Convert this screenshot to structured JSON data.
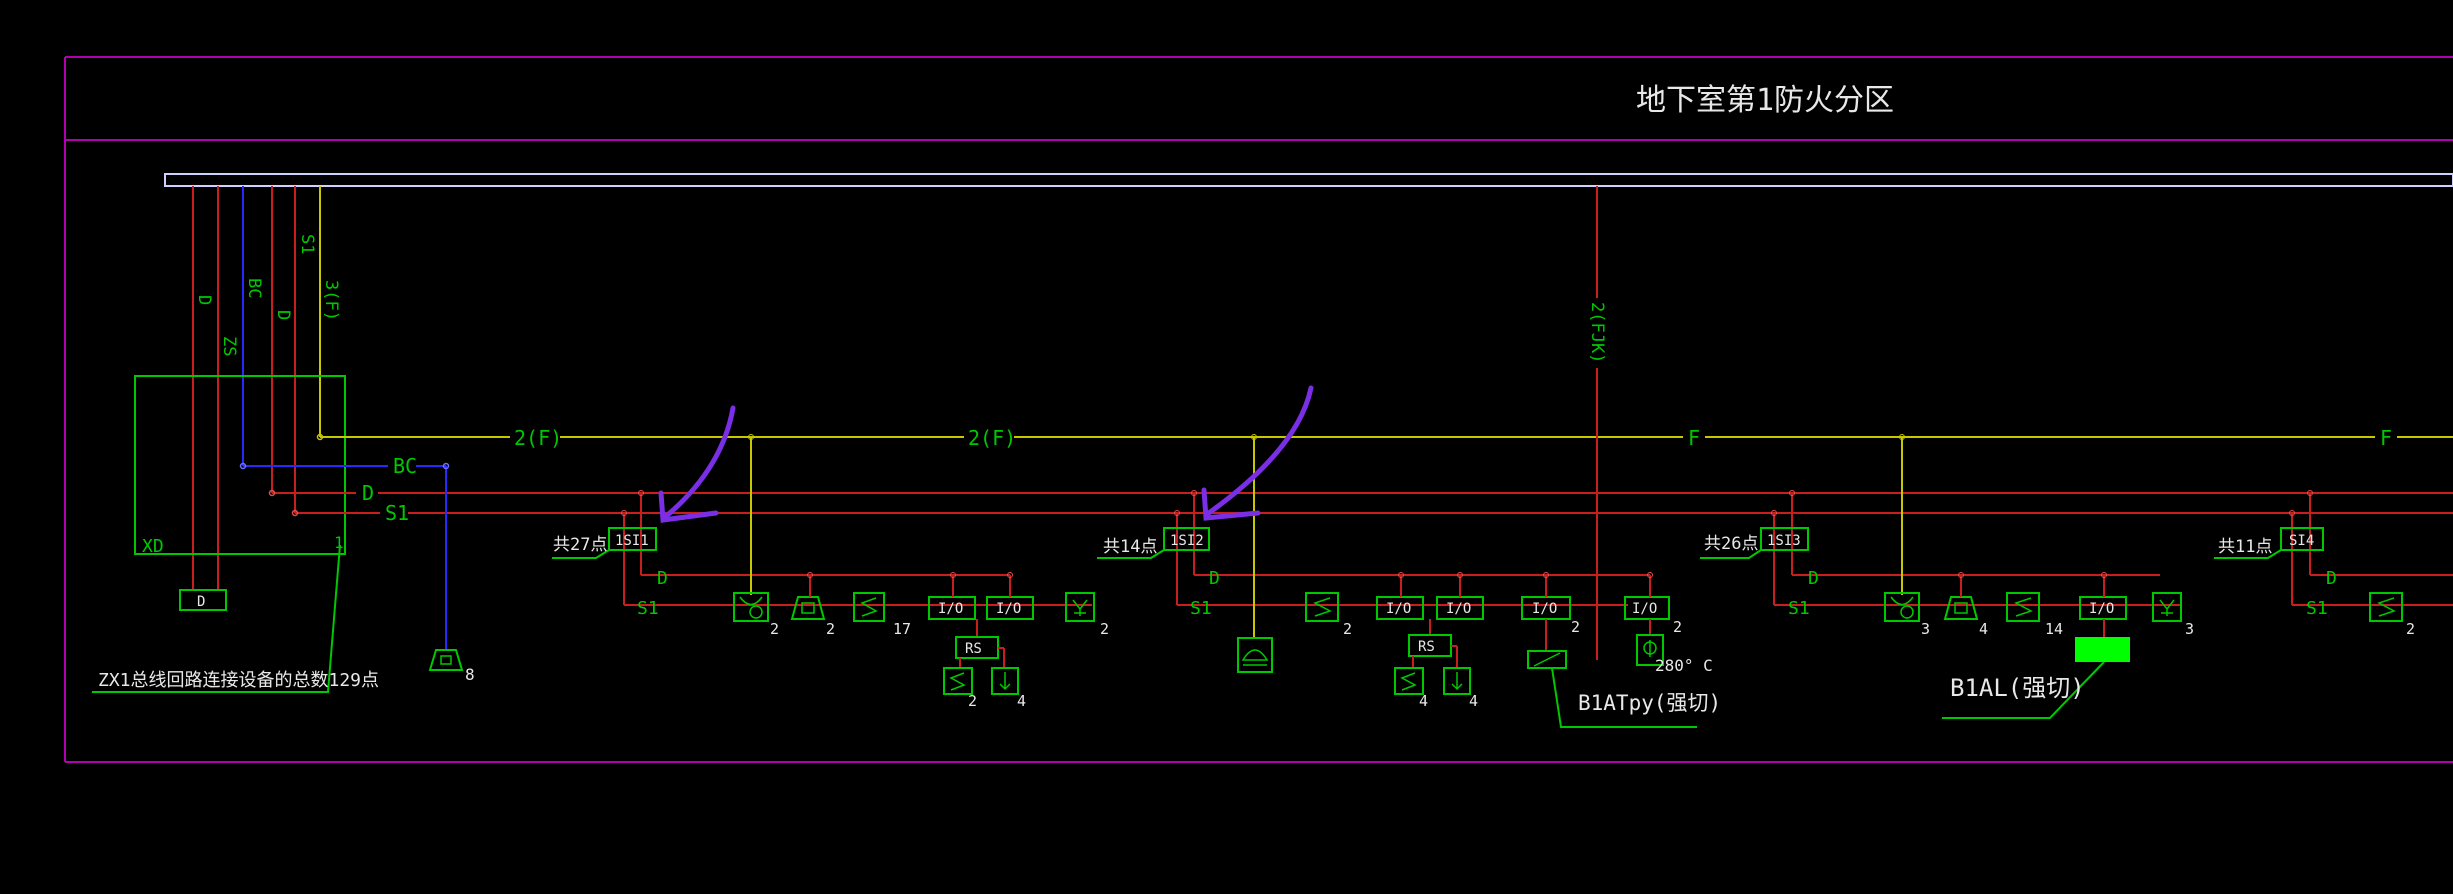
{
  "colors": {
    "background": "#000000",
    "frame": "#b000b0",
    "bus": "#d0d0ff",
    "red_line": "#c81e1e",
    "yellow_line": "#c8c800",
    "blue_line": "#2828ff",
    "green": "#00c800",
    "white_text": "#e8e8e8",
    "annotation": "#7a2ee6",
    "filled_box": "#00ff00"
  },
  "title": "地下室第1防火分区",
  "riser_labels": {
    "d1": "D",
    "zs": "ZS",
    "bc": "BC",
    "d2": "D",
    "s1": "S1",
    "f3": "3(F)"
  },
  "panel": {
    "name": "XD",
    "sub_box": "D",
    "corner_mark": "1",
    "total_note": "ZX1总线回路连接设备的总数129点"
  },
  "horizontal_labels": {
    "bc": "BC",
    "d": "D",
    "s1": "S1",
    "f_seg1": "2(F)",
    "f_seg2": "2(F)",
    "f_seg3": "F",
    "f_seg4": "F"
  },
  "bc_device_count": "8",
  "vertical_fjk": "2(FJK)",
  "loops": [
    {
      "count_text": "共27点",
      "module": "1SI1",
      "d": "D",
      "s1": "S1",
      "devices": [
        {
          "icon": "smoke-detector-icon",
          "count": "2"
        },
        {
          "icon": "manual-alarm-icon",
          "count": "2"
        },
        {
          "icon": "heat-detector-icon",
          "count": "17"
        },
        {
          "icon": "io-module-icon",
          "label": "I/O"
        },
        {
          "icon": "io-module-icon",
          "label": "I/O"
        },
        {
          "icon": "hydrant-button-icon",
          "count": "2"
        }
      ],
      "rs_label": "RS",
      "sub_devices": [
        {
          "icon": "heat-detector-icon",
          "count": "2"
        },
        {
          "icon": "down-arrow-icon",
          "count": "4"
        }
      ]
    },
    {
      "count_text": "共14点",
      "module": "1SI2",
      "d": "D",
      "s1": "S1",
      "devices": [
        {
          "icon": "heat-detector-icon",
          "count": "2"
        },
        {
          "icon": "io-module-icon",
          "label": "I/O"
        },
        {
          "icon": "io-module-icon",
          "label": "I/O"
        },
        {
          "icon": "io-module-icon",
          "label": "I/O",
          "count": "2"
        },
        {
          "icon": "io-module-icon",
          "label": "I/O",
          "count": "2"
        }
      ],
      "rs_label": "RS",
      "sub_devices": [
        {
          "icon": "heat-detector-icon",
          "count": "4"
        },
        {
          "icon": "down-arrow-icon",
          "count": "4"
        }
      ],
      "phone_icon": "telephone-icon",
      "damper_text": "280° C",
      "cabinet": "B1ATpy(强切)"
    },
    {
      "count_text": "共26点",
      "module": "1SI3",
      "d": "D",
      "s1": "S1",
      "devices": [
        {
          "icon": "smoke-detector-icon",
          "count": "3"
        },
        {
          "icon": "manual-alarm-icon",
          "count": "4"
        },
        {
          "icon": "heat-detector-icon",
          "count": "14"
        },
        {
          "icon": "io-module-icon",
          "label": "I/O"
        },
        {
          "icon": "hydrant-button-icon",
          "count": "3"
        }
      ],
      "cabinet": "B1AL(强切)"
    },
    {
      "count_text": "共11点",
      "module": "SI4",
      "d": "D",
      "s1": "S1",
      "devices": [
        {
          "icon": "heat-detector-icon",
          "count": "2"
        }
      ]
    }
  ]
}
